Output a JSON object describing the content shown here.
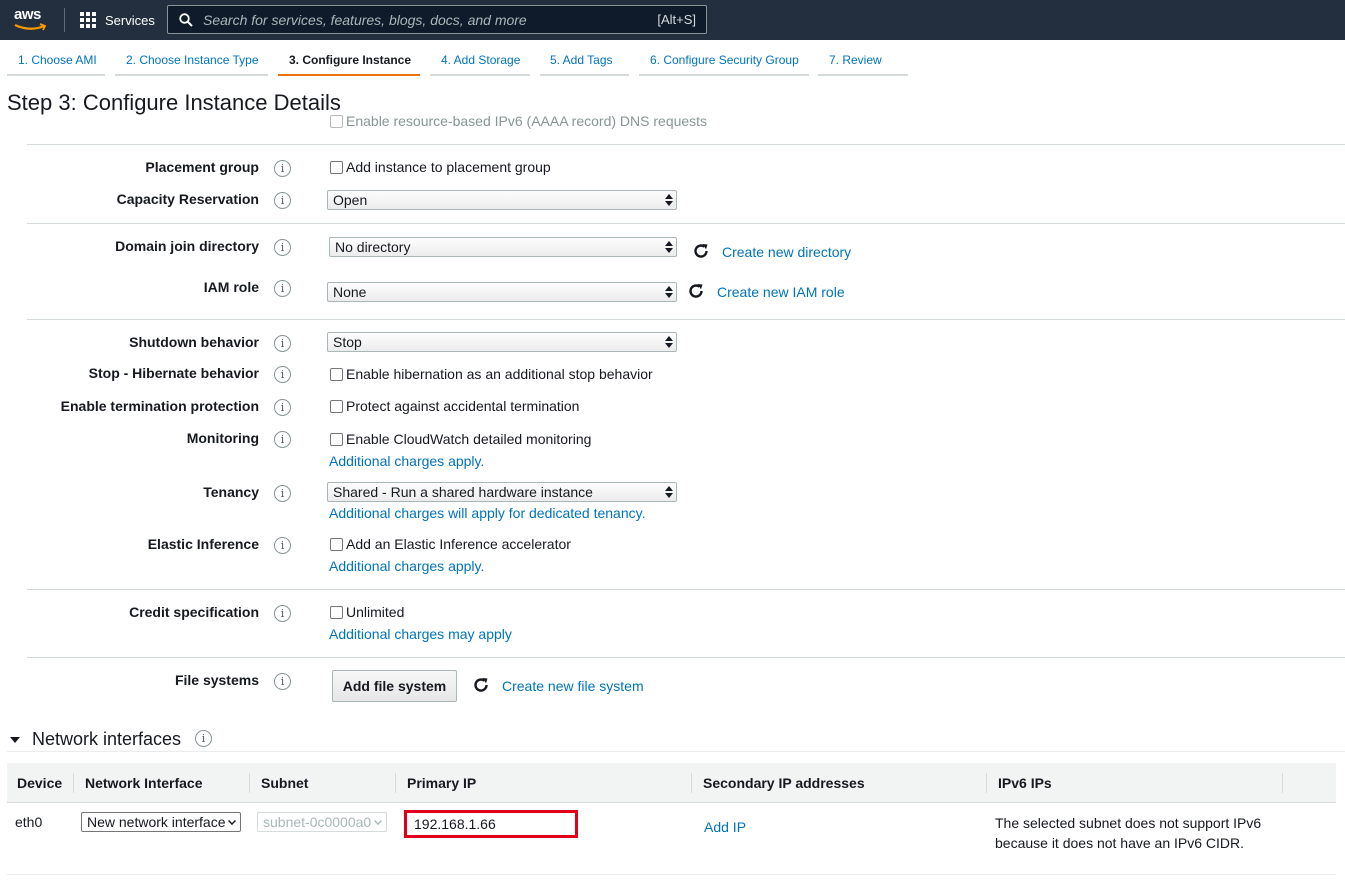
{
  "nav": {
    "logo_text": "aws",
    "services_label": "Services",
    "search_placeholder": "Search for services, features, blogs, docs, and more",
    "search_shortcut": "[Alt+S]"
  },
  "wizard": {
    "tabs": [
      {
        "label": "1. Choose AMI",
        "active": false
      },
      {
        "label": "2. Choose Instance Type",
        "active": false
      },
      {
        "label": "3. Configure Instance",
        "active": true
      },
      {
        "label": "4. Add Storage",
        "active": false
      },
      {
        "label": "5. Add Tags",
        "active": false
      },
      {
        "label": "6. Configure Security Group",
        "active": false
      },
      {
        "label": "7. Review",
        "active": false
      }
    ]
  },
  "page": {
    "title": "Step 3: Configure Instance Details",
    "ghost_option": "Enable resource-based IPv6 (AAAA record) DNS requests"
  },
  "fields": {
    "placement_group": {
      "label": "Placement group",
      "checkbox": "Add instance to placement group"
    },
    "capacity_reservation": {
      "label": "Capacity Reservation",
      "value": "Open"
    },
    "domain_join": {
      "label": "Domain join directory",
      "value": "No directory",
      "link": "Create new directory"
    },
    "iam_role": {
      "label": "IAM role",
      "value": "None",
      "link": "Create new IAM role"
    },
    "shutdown": {
      "label": "Shutdown behavior",
      "value": "Stop"
    },
    "hibernate": {
      "label": "Stop - Hibernate behavior",
      "checkbox": "Enable hibernation as an additional stop behavior"
    },
    "termination": {
      "label": "Enable termination protection",
      "checkbox": "Protect against accidental termination"
    },
    "monitoring": {
      "label": "Monitoring",
      "checkbox": "Enable CloudWatch detailed monitoring",
      "note": "Additional charges apply."
    },
    "tenancy": {
      "label": "Tenancy",
      "value": "Shared - Run a shared hardware instance",
      "note": "Additional charges will apply for dedicated tenancy."
    },
    "elastic_inference": {
      "label": "Elastic Inference",
      "checkbox": "Add an Elastic Inference accelerator",
      "note": "Additional charges apply."
    },
    "credit": {
      "label": "Credit specification",
      "checkbox": "Unlimited",
      "note": "Additional charges may apply"
    },
    "file_systems": {
      "label": "File systems",
      "button": "Add file system",
      "link": "Create new file system"
    }
  },
  "network": {
    "heading": "Network interfaces",
    "columns": [
      "Device",
      "Network Interface",
      "Subnet",
      "Primary IP",
      "Secondary IP addresses",
      "IPv6 IPs"
    ],
    "row": {
      "device": "eth0",
      "interface": "New network interface",
      "subnet": "subnet-0c0000a0",
      "primary_ip": "192.168.1.66",
      "add_ip": "Add IP",
      "ipv6_line1": "The selected subnet does not support IPv6",
      "ipv6_line2": "because it does not have an IPv6 CIDR."
    }
  },
  "colors": {
    "nav_bg": "#232f3e",
    "link": "#0073bb",
    "active_tab": "#ec7211",
    "highlight": "#e0001b"
  }
}
